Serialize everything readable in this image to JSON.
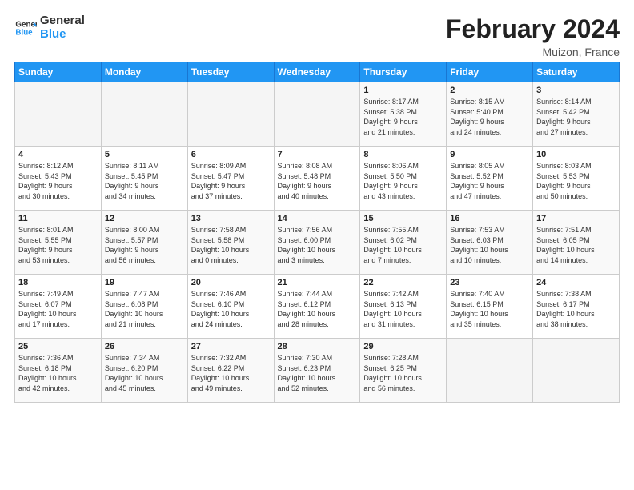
{
  "header": {
    "logo_line1": "General",
    "logo_line2": "Blue",
    "month_title": "February 2024",
    "location": "Muizon, France"
  },
  "days_of_week": [
    "Sunday",
    "Monday",
    "Tuesday",
    "Wednesday",
    "Thursday",
    "Friday",
    "Saturday"
  ],
  "weeks": [
    [
      {
        "day": "",
        "info": ""
      },
      {
        "day": "",
        "info": ""
      },
      {
        "day": "",
        "info": ""
      },
      {
        "day": "",
        "info": ""
      },
      {
        "day": "1",
        "info": "Sunrise: 8:17 AM\nSunset: 5:38 PM\nDaylight: 9 hours\nand 21 minutes."
      },
      {
        "day": "2",
        "info": "Sunrise: 8:15 AM\nSunset: 5:40 PM\nDaylight: 9 hours\nand 24 minutes."
      },
      {
        "day": "3",
        "info": "Sunrise: 8:14 AM\nSunset: 5:42 PM\nDaylight: 9 hours\nand 27 minutes."
      }
    ],
    [
      {
        "day": "4",
        "info": "Sunrise: 8:12 AM\nSunset: 5:43 PM\nDaylight: 9 hours\nand 30 minutes."
      },
      {
        "day": "5",
        "info": "Sunrise: 8:11 AM\nSunset: 5:45 PM\nDaylight: 9 hours\nand 34 minutes."
      },
      {
        "day": "6",
        "info": "Sunrise: 8:09 AM\nSunset: 5:47 PM\nDaylight: 9 hours\nand 37 minutes."
      },
      {
        "day": "7",
        "info": "Sunrise: 8:08 AM\nSunset: 5:48 PM\nDaylight: 9 hours\nand 40 minutes."
      },
      {
        "day": "8",
        "info": "Sunrise: 8:06 AM\nSunset: 5:50 PM\nDaylight: 9 hours\nand 43 minutes."
      },
      {
        "day": "9",
        "info": "Sunrise: 8:05 AM\nSunset: 5:52 PM\nDaylight: 9 hours\nand 47 minutes."
      },
      {
        "day": "10",
        "info": "Sunrise: 8:03 AM\nSunset: 5:53 PM\nDaylight: 9 hours\nand 50 minutes."
      }
    ],
    [
      {
        "day": "11",
        "info": "Sunrise: 8:01 AM\nSunset: 5:55 PM\nDaylight: 9 hours\nand 53 minutes."
      },
      {
        "day": "12",
        "info": "Sunrise: 8:00 AM\nSunset: 5:57 PM\nDaylight: 9 hours\nand 56 minutes."
      },
      {
        "day": "13",
        "info": "Sunrise: 7:58 AM\nSunset: 5:58 PM\nDaylight: 10 hours\nand 0 minutes."
      },
      {
        "day": "14",
        "info": "Sunrise: 7:56 AM\nSunset: 6:00 PM\nDaylight: 10 hours\nand 3 minutes."
      },
      {
        "day": "15",
        "info": "Sunrise: 7:55 AM\nSunset: 6:02 PM\nDaylight: 10 hours\nand 7 minutes."
      },
      {
        "day": "16",
        "info": "Sunrise: 7:53 AM\nSunset: 6:03 PM\nDaylight: 10 hours\nand 10 minutes."
      },
      {
        "day": "17",
        "info": "Sunrise: 7:51 AM\nSunset: 6:05 PM\nDaylight: 10 hours\nand 14 minutes."
      }
    ],
    [
      {
        "day": "18",
        "info": "Sunrise: 7:49 AM\nSunset: 6:07 PM\nDaylight: 10 hours\nand 17 minutes."
      },
      {
        "day": "19",
        "info": "Sunrise: 7:47 AM\nSunset: 6:08 PM\nDaylight: 10 hours\nand 21 minutes."
      },
      {
        "day": "20",
        "info": "Sunrise: 7:46 AM\nSunset: 6:10 PM\nDaylight: 10 hours\nand 24 minutes."
      },
      {
        "day": "21",
        "info": "Sunrise: 7:44 AM\nSunset: 6:12 PM\nDaylight: 10 hours\nand 28 minutes."
      },
      {
        "day": "22",
        "info": "Sunrise: 7:42 AM\nSunset: 6:13 PM\nDaylight: 10 hours\nand 31 minutes."
      },
      {
        "day": "23",
        "info": "Sunrise: 7:40 AM\nSunset: 6:15 PM\nDaylight: 10 hours\nand 35 minutes."
      },
      {
        "day": "24",
        "info": "Sunrise: 7:38 AM\nSunset: 6:17 PM\nDaylight: 10 hours\nand 38 minutes."
      }
    ],
    [
      {
        "day": "25",
        "info": "Sunrise: 7:36 AM\nSunset: 6:18 PM\nDaylight: 10 hours\nand 42 minutes."
      },
      {
        "day": "26",
        "info": "Sunrise: 7:34 AM\nSunset: 6:20 PM\nDaylight: 10 hours\nand 45 minutes."
      },
      {
        "day": "27",
        "info": "Sunrise: 7:32 AM\nSunset: 6:22 PM\nDaylight: 10 hours\nand 49 minutes."
      },
      {
        "day": "28",
        "info": "Sunrise: 7:30 AM\nSunset: 6:23 PM\nDaylight: 10 hours\nand 52 minutes."
      },
      {
        "day": "29",
        "info": "Sunrise: 7:28 AM\nSunset: 6:25 PM\nDaylight: 10 hours\nand 56 minutes."
      },
      {
        "day": "",
        "info": ""
      },
      {
        "day": "",
        "info": ""
      }
    ]
  ]
}
